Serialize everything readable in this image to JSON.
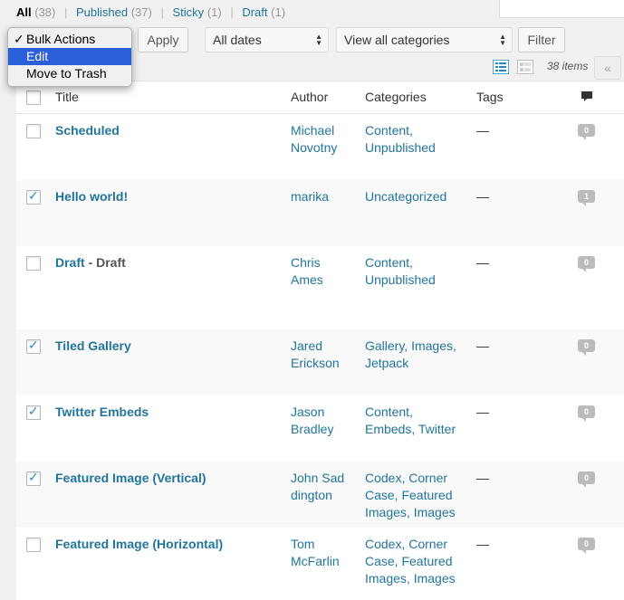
{
  "status_links": [
    {
      "label": "All",
      "count": "(38)",
      "current": true
    },
    {
      "label": "Published",
      "count": "(37)"
    },
    {
      "label": "Sticky",
      "count": "(1)"
    },
    {
      "label": "Draft",
      "count": "(1)"
    }
  ],
  "bulk_actions": {
    "options": [
      {
        "label": "Bulk Actions",
        "checked": true
      },
      {
        "label": "Edit",
        "highlighted": true
      },
      {
        "label": "Move to Trash"
      }
    ],
    "apply_label": "Apply"
  },
  "filters": {
    "dates_label": "All dates",
    "categories_label": "View all categories",
    "filter_label": "Filter"
  },
  "pagination": {
    "items_count": "38 items",
    "first_page": "«"
  },
  "icons": {
    "list_view": "list-view-icon",
    "excerpt_view": "excerpt-view-icon",
    "comments": "comment-bubble-icon"
  },
  "colors": {
    "link": "#21759b",
    "highlight": "#2b5fd9",
    "bubble": "#bbbbbb"
  },
  "table": {
    "headers": {
      "title": "Title",
      "author": "Author",
      "categories": "Categories",
      "tags": "Tags"
    },
    "rows": [
      {
        "title": "Scheduled",
        "state": "",
        "author": "Michael Novotny",
        "categories": "Content, Unpublished",
        "tags": "—",
        "comments": "0",
        "checked": false
      },
      {
        "title": "Hello world!",
        "state": "",
        "author": "marika",
        "categories": "Uncategorized",
        "tags": "—",
        "comments": "1",
        "checked": true
      },
      {
        "title": "Draft",
        "state": " - Draft",
        "author": "Chris Ames",
        "categories": "Content, Unpublished",
        "tags": "—",
        "comments": "0",
        "checked": false
      },
      {
        "title": "Tiled Gallery",
        "state": "",
        "author": "Jared Erickson",
        "categories": "Gallery, Images, Jetpack",
        "tags": "—",
        "comments": "0",
        "checked": true
      },
      {
        "title": "Twitter Embeds",
        "state": "",
        "author": "Jason Bradley",
        "categories": "Content, Embeds, Twitter",
        "tags": "—",
        "comments": "0",
        "checked": true
      },
      {
        "title": "Featured Image (Vertical)",
        "state": "",
        "author": "John Saddington",
        "categories": "Codex, Corner Case, Featured Images, Images",
        "tags": "—",
        "comments": "0",
        "checked": true
      },
      {
        "title": "Featured Image (Horizontal)",
        "state": "",
        "author": "Tom McFarlin",
        "categories": "Codex, Corner Case, Featured Images, Images",
        "tags": "—",
        "comments": "0",
        "checked": false
      }
    ]
  }
}
